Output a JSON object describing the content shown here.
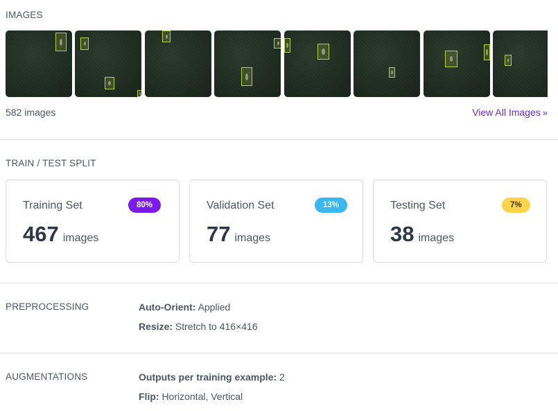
{
  "images": {
    "heading": "IMAGES",
    "count_label": "582 images",
    "view_all_label": "View All Images",
    "thumbnails": [
      {
        "alt": "thumbnail-1"
      },
      {
        "alt": "thumbnail-2"
      },
      {
        "alt": "thumbnail-3"
      },
      {
        "alt": "thumbnail-4"
      },
      {
        "alt": "thumbnail-5"
      },
      {
        "alt": "thumbnail-6"
      },
      {
        "alt": "thumbnail-7"
      },
      {
        "alt": "thumbnail-8"
      }
    ]
  },
  "split": {
    "heading": "TRAIN / TEST SPLIT",
    "cards": [
      {
        "title": "Training Set",
        "badge": "80%",
        "count": "467",
        "unit": "images",
        "badge_color": "#7c1aeb",
        "badge_text_color": "#ffffff"
      },
      {
        "title": "Validation Set",
        "badge": "13%",
        "count": "77",
        "unit": "images",
        "badge_color": "#3ab7ee",
        "badge_text_color": "#ffffff"
      },
      {
        "title": "Testing Set",
        "badge": "7%",
        "count": "38",
        "unit": "images",
        "badge_color": "#fcd34d",
        "badge_text_color": "#3f3300"
      }
    ]
  },
  "preprocessing": {
    "heading": "PREPROCESSING",
    "rows": [
      {
        "key": "Auto-Orient:",
        "value": "Applied"
      },
      {
        "key": "Resize:",
        "value": "Stretch to 416×416"
      }
    ]
  },
  "augmentations": {
    "heading": "AUGMENTATIONS",
    "rows": [
      {
        "key": "Outputs per training example:",
        "value": "2"
      },
      {
        "key": "Flip:",
        "value": "Horizontal, Vertical"
      }
    ]
  },
  "colors": {
    "accent_link": "#6d28d9",
    "bbox": "#b6d63a"
  }
}
